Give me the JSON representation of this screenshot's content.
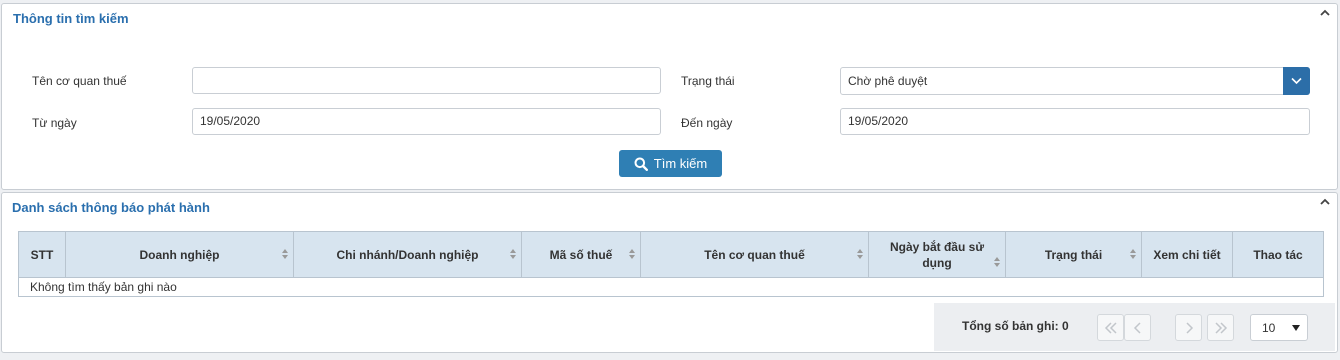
{
  "search_panel": {
    "title": "Thông tin tìm kiếm",
    "tax_agency_label": "Tên cơ quan thuế",
    "tax_agency_value": "",
    "status_label": "Trạng thái",
    "status_value": "Chờ phê duyệt",
    "from_label": "Từ ngày",
    "from_value": "19/05/2020",
    "to_label": "Đến ngày",
    "to_value": "19/05/2020",
    "search_button": "Tìm kiếm"
  },
  "list_panel": {
    "title": "Danh sách thông báo phát hành",
    "columns": [
      {
        "label": "STT"
      },
      {
        "label": "Doanh nghiệp"
      },
      {
        "label": "Chi nhánh/Doanh nghiệp"
      },
      {
        "label": "Mã số thuế"
      },
      {
        "label": "Tên cơ quan thuế"
      },
      {
        "label": "Ngày bắt đầu sử dụng"
      },
      {
        "label": "Trạng thái"
      },
      {
        "label": "Xem chi tiết"
      },
      {
        "label": "Thao tác"
      }
    ],
    "empty_message": "Không tìm thấy bản ghi nào",
    "total_label": "Tổng số bản ghi: 0",
    "page_size": "10"
  },
  "colors": {
    "accent": "#2c6ea8",
    "title": "#2a6fae",
    "table_header": "#d7e4ef"
  }
}
